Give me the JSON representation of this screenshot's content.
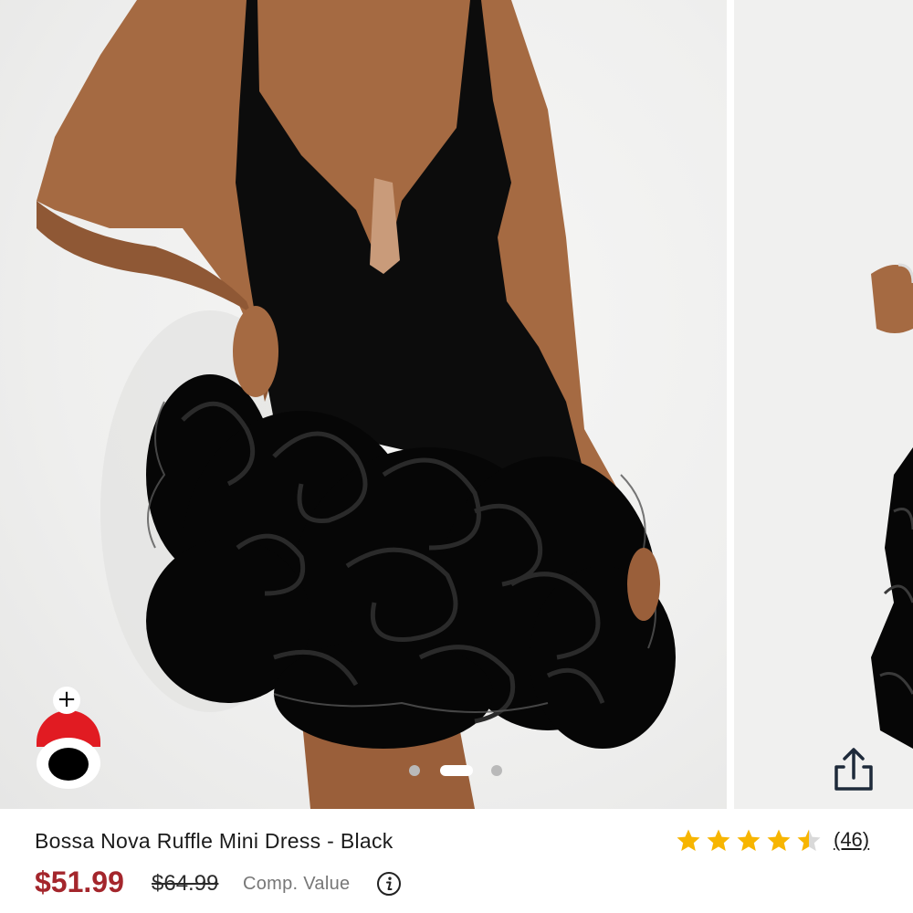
{
  "product": {
    "title": "Bossa Nova Ruffle Mini Dress - Black",
    "sale_price": "$51.99",
    "original_price": "$64.99",
    "comp_label": "Comp. Value",
    "rating": 4.5,
    "rating_max": 5,
    "review_count": "(46)"
  },
  "gallery": {
    "slide_count": 3,
    "active_slide": 1,
    "bag_plus": "+"
  },
  "colors": {
    "sale_price": "#a4262c",
    "star_filled": "#f7b500",
    "star_empty": "#d9d9d9",
    "bag_red": "#e11b22"
  },
  "icons": [
    "plus-icon",
    "shopping-bag-icon",
    "share-icon",
    "info-icon",
    "star-icon"
  ]
}
